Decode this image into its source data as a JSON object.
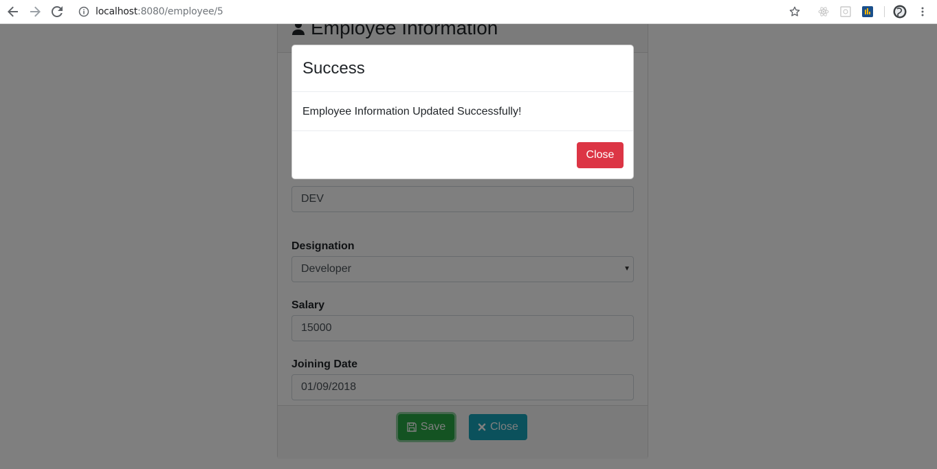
{
  "browser": {
    "url_host": "localhost",
    "url_path": ":8080/employee/5"
  },
  "card": {
    "title": "Employee Information",
    "fields": [
      {
        "label": "",
        "value": "DEV"
      },
      {
        "label": "Designation",
        "value": "Developer"
      },
      {
        "label": "Salary",
        "value": "15000"
      },
      {
        "label": "Joining Date",
        "value": "01/09/2018"
      }
    ],
    "save_label": "Save",
    "close_label": "Close"
  },
  "modal": {
    "title": "Success",
    "message": "Employee Information Updated Successfully!",
    "close_label": "Close"
  },
  "colors": {
    "save": "#28a745",
    "close_card": "#17a2b8",
    "close_modal": "#dc3545"
  },
  "icons": {
    "back": "back-arrow-icon",
    "forward": "forward-arrow-icon",
    "reload": "reload-icon",
    "info": "info-icon",
    "bookmark": "star-icon",
    "menu": "kebab-menu-icon",
    "user": "user-icon",
    "save": "floppy-disk-icon",
    "close": "x-icon"
  }
}
